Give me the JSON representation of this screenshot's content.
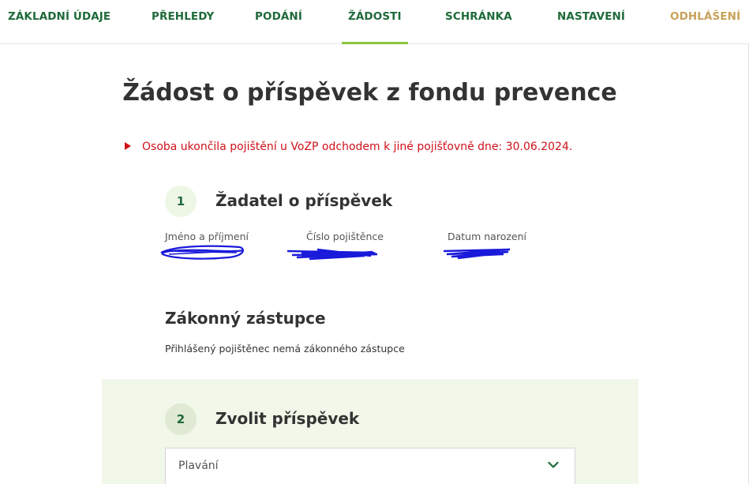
{
  "nav": {
    "items": [
      {
        "label": "ZÁKLADNÍ ÚDAJE",
        "active": false
      },
      {
        "label": "PŘEHLEDY",
        "active": false
      },
      {
        "label": "PODÁNÍ",
        "active": false
      },
      {
        "label": "ŽÁDOSTI",
        "active": true
      },
      {
        "label": "SCHRÁNKA",
        "active": false
      },
      {
        "label": "NASTAVENÍ",
        "active": false
      }
    ],
    "logout_label": "ODHLÁŠENÍ"
  },
  "page": {
    "title": "Žádost o příspěvek z fondu prevence"
  },
  "alert": {
    "text": "Osoba ukončila pojištění u VoZP odchodem k jiné pojišťovně dne: 30.06.2024."
  },
  "applicant": {
    "step": "1",
    "title": "Žadatel o příspěvek",
    "fields": [
      {
        "label": "Jméno a příjmení"
      },
      {
        "label": "Číslo pojištěnce"
      },
      {
        "label": "Datum narození"
      }
    ]
  },
  "legal_rep": {
    "title": "Zákonný zástupce",
    "text": "Přihlášený pojištěnec nemá zákonného zástupce"
  },
  "contribution": {
    "step": "2",
    "title": "Zvolit příspěvek",
    "selected": "Plavání"
  },
  "colors": {
    "nav_text": "#1f6a3a",
    "nav_active_underline": "#8cc63f",
    "logout": "#c8a25a",
    "alert": "#d0111b",
    "panel_bg": "#f1f7e9",
    "redaction": "#1a1adb"
  },
  "icons": {
    "alert": "triangle-right-icon",
    "select": "chevron-down-icon"
  }
}
